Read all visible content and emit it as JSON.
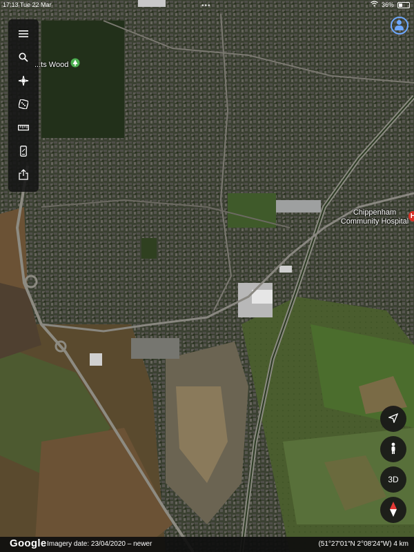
{
  "status_bar": {
    "time": "17:13",
    "date": "Tue 22 Mar",
    "battery": "36%"
  },
  "toolbar": {
    "items": [
      {
        "icon": "menu-icon",
        "label": "Menu"
      },
      {
        "icon": "search-icon",
        "label": "Search"
      },
      {
        "icon": "voyager-icon",
        "label": "Voyager"
      },
      {
        "icon": "dice-icon",
        "label": "I'm feeling lucky"
      },
      {
        "icon": "ruler-icon",
        "label": "Measure"
      },
      {
        "icon": "phone-icon",
        "label": "Projects"
      },
      {
        "icon": "share-icon",
        "label": "Share"
      }
    ]
  },
  "map": {
    "labels": {
      "wood": "...ts Wood",
      "hospital": "Chippenham Community Hospital"
    },
    "hospital_badge": "H"
  },
  "controls": {
    "location": "locate-icon",
    "pegman": "pegman-icon",
    "three_d": "3D",
    "compass": "compass-icon"
  },
  "footer": {
    "logo": "Google",
    "imagery": "Imagery date: 23/04/2020 – newer",
    "coords": "(51°27′01″N 2°08′24″W) 4 km"
  },
  "colors": {
    "accent": "#6ea8ff",
    "pin_green": "#4caf50",
    "hospital_red": "#d93025"
  }
}
